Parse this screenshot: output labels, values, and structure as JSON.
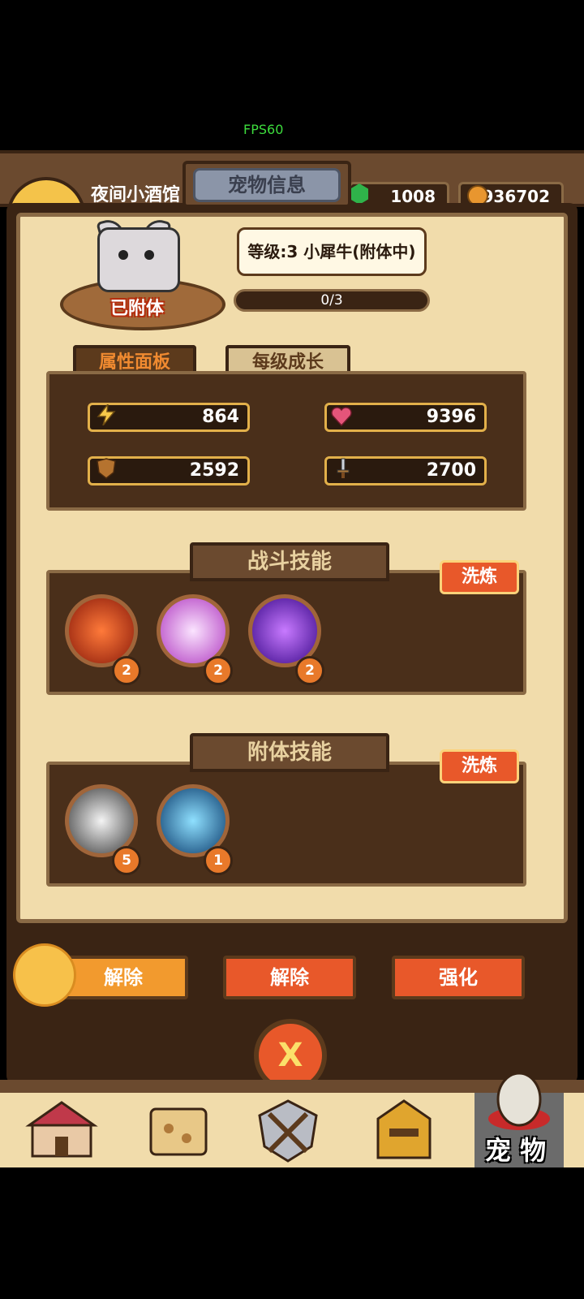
{
  "status": {
    "fps": "FPS60"
  },
  "top": {
    "tavern_name": "夜间小酒馆",
    "gems": "1008",
    "coins": "936702"
  },
  "panel": {
    "title": "宠物信息"
  },
  "pet": {
    "attached_label": "已附体",
    "level_text": "等级:3 小犀牛(附体中)",
    "exp_text": "0/3"
  },
  "tabs": {
    "attributes": "属性面板",
    "growth": "每级成长"
  },
  "stats": {
    "energy": "864",
    "health": "9396",
    "defense": "2592",
    "attack": "2700"
  },
  "combat_skills": {
    "title": "战斗技能",
    "refine_label": "洗炼",
    "levels": [
      "2",
      "2",
      "2"
    ]
  },
  "possession_skills": {
    "title": "附体技能",
    "refine_label": "洗炼",
    "levels": [
      "5",
      "1"
    ]
  },
  "actions": {
    "release_1": "解除",
    "release_2": "解除",
    "enhance": "强化",
    "close": "X"
  },
  "nav": {
    "active_label": "宠 物"
  },
  "colors": {
    "panel_bg": "#f1dcab",
    "wood": "#6b4a2f",
    "accent": "#e8582a"
  }
}
